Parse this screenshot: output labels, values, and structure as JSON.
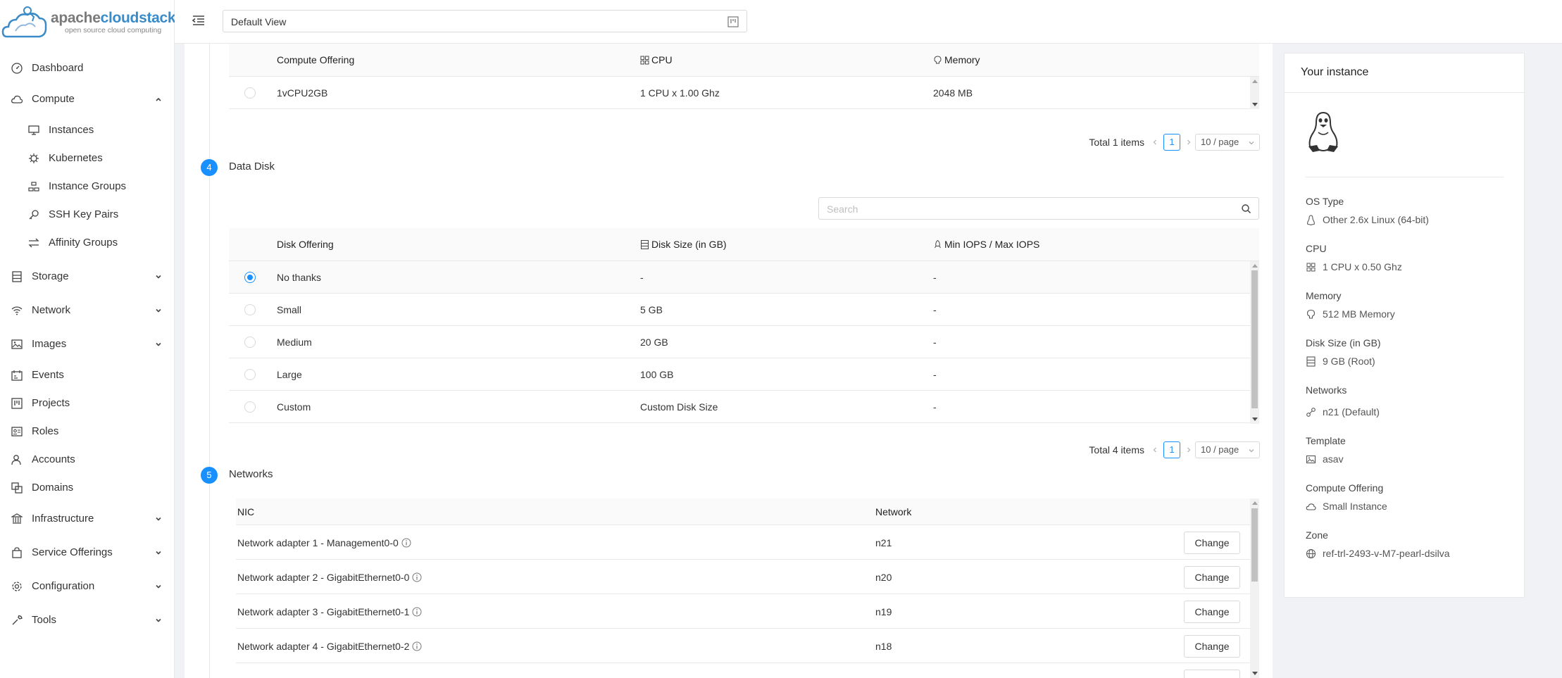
{
  "app": {
    "brand_a": "apache",
    "brand_b": "cloudstack",
    "tagline": "open source cloud computing"
  },
  "header": {
    "view": "Default View"
  },
  "sidebar": {
    "items": [
      {
        "label": "Dashboard",
        "icon": "dashboard-icon"
      },
      {
        "label": "Compute",
        "icon": "cloud-icon",
        "expanded": true
      },
      {
        "label": "Instances",
        "icon": "desktop-icon",
        "sub": true
      },
      {
        "label": "Kubernetes",
        "icon": "kubernetes-icon",
        "sub": true
      },
      {
        "label": "Instance Groups",
        "icon": "gold-icon",
        "sub": true
      },
      {
        "label": "SSH Key Pairs",
        "icon": "key-icon",
        "sub": true
      },
      {
        "label": "Affinity Groups",
        "icon": "swap-icon",
        "sub": true
      },
      {
        "label": "Storage",
        "icon": "database-icon"
      },
      {
        "label": "Network",
        "icon": "wifi-icon"
      },
      {
        "label": "Images",
        "icon": "picture-icon"
      },
      {
        "label": "Events",
        "icon": "schedule-icon"
      },
      {
        "label": "Projects",
        "icon": "project-icon"
      },
      {
        "label": "Roles",
        "icon": "idcard-icon"
      },
      {
        "label": "Accounts",
        "icon": "team-icon"
      },
      {
        "label": "Domains",
        "icon": "block-icon"
      },
      {
        "label": "Infrastructure",
        "icon": "bank-icon"
      },
      {
        "label": "Service Offerings",
        "icon": "shopping-icon"
      },
      {
        "label": "Configuration",
        "icon": "setting-icon"
      },
      {
        "label": "Tools",
        "icon": "tool-icon"
      }
    ]
  },
  "compute": {
    "headers": {
      "offering": "Compute Offering",
      "cpu": "CPU",
      "memory": "Memory"
    },
    "rows": [
      {
        "name": "1vCPU2GB",
        "cpu": "1 CPU x 1.00 Ghz",
        "memory": "2048 MB",
        "selected": false
      }
    ],
    "total": "Total 1 items",
    "page": "1",
    "page_size": "10 / page"
  },
  "data_disk": {
    "step": "4",
    "title": "Data Disk",
    "search_placeholder": "Search",
    "headers": {
      "offering": "Disk Offering",
      "size": "Disk Size (in GB)",
      "iops": "Min IOPS / Max IOPS"
    },
    "rows": [
      {
        "name": "No thanks",
        "size": "-",
        "iops": "-",
        "selected": true
      },
      {
        "name": "Small",
        "size": "5 GB",
        "iops": "-",
        "selected": false
      },
      {
        "name": "Medium",
        "size": "20 GB",
        "iops": "-",
        "selected": false
      },
      {
        "name": "Large",
        "size": "100 GB",
        "iops": "-",
        "selected": false
      },
      {
        "name": "Custom",
        "size": "Custom Disk Size",
        "iops": "-",
        "selected": false
      }
    ],
    "total": "Total 4 items",
    "page": "1",
    "page_size": "10 / page"
  },
  "networks": {
    "step": "5",
    "title": "Networks",
    "headers": {
      "nic": "NIC",
      "network": "Network"
    },
    "change_label": "Change",
    "rows": [
      {
        "nic": "Network adapter 1 - Management0-0",
        "network": "n21"
      },
      {
        "nic": "Network adapter 2 - GigabitEthernet0-0",
        "network": "n20"
      },
      {
        "nic": "Network adapter 3 - GigabitEthernet0-1",
        "network": "n19"
      },
      {
        "nic": "Network adapter 4 - GigabitEthernet0-2",
        "network": "n18"
      }
    ]
  },
  "instance": {
    "title": "Your instance",
    "fields": [
      {
        "key": "OS Type",
        "value": "Other 2.6x Linux (64-bit)",
        "icon": "linux-icon"
      },
      {
        "key": "CPU",
        "value": "1 CPU x 0.50 Ghz",
        "icon": "appstore-icon"
      },
      {
        "key": "Memory",
        "value": "512 MB Memory",
        "icon": "bulb-icon"
      },
      {
        "key": "Disk Size (in GB)",
        "value": "9 GB (Root)",
        "icon": "hdd-icon"
      },
      {
        "key": "Networks",
        "value": "n21 (Default)",
        "icon": "api-icon"
      },
      {
        "key": "Template",
        "value": "asav",
        "icon": "picture-icon"
      },
      {
        "key": "Compute Offering",
        "value": "Small Instance",
        "icon": "cloud-icon"
      },
      {
        "key": "Zone",
        "value": "ref-trl-2493-v-M7-pearl-dsilva",
        "icon": "global-icon"
      }
    ]
  },
  "colors": {
    "accent": "#1890ff",
    "brand_blue": "#3a8bc8",
    "text": "#333333",
    "border": "#e8e8e8"
  }
}
